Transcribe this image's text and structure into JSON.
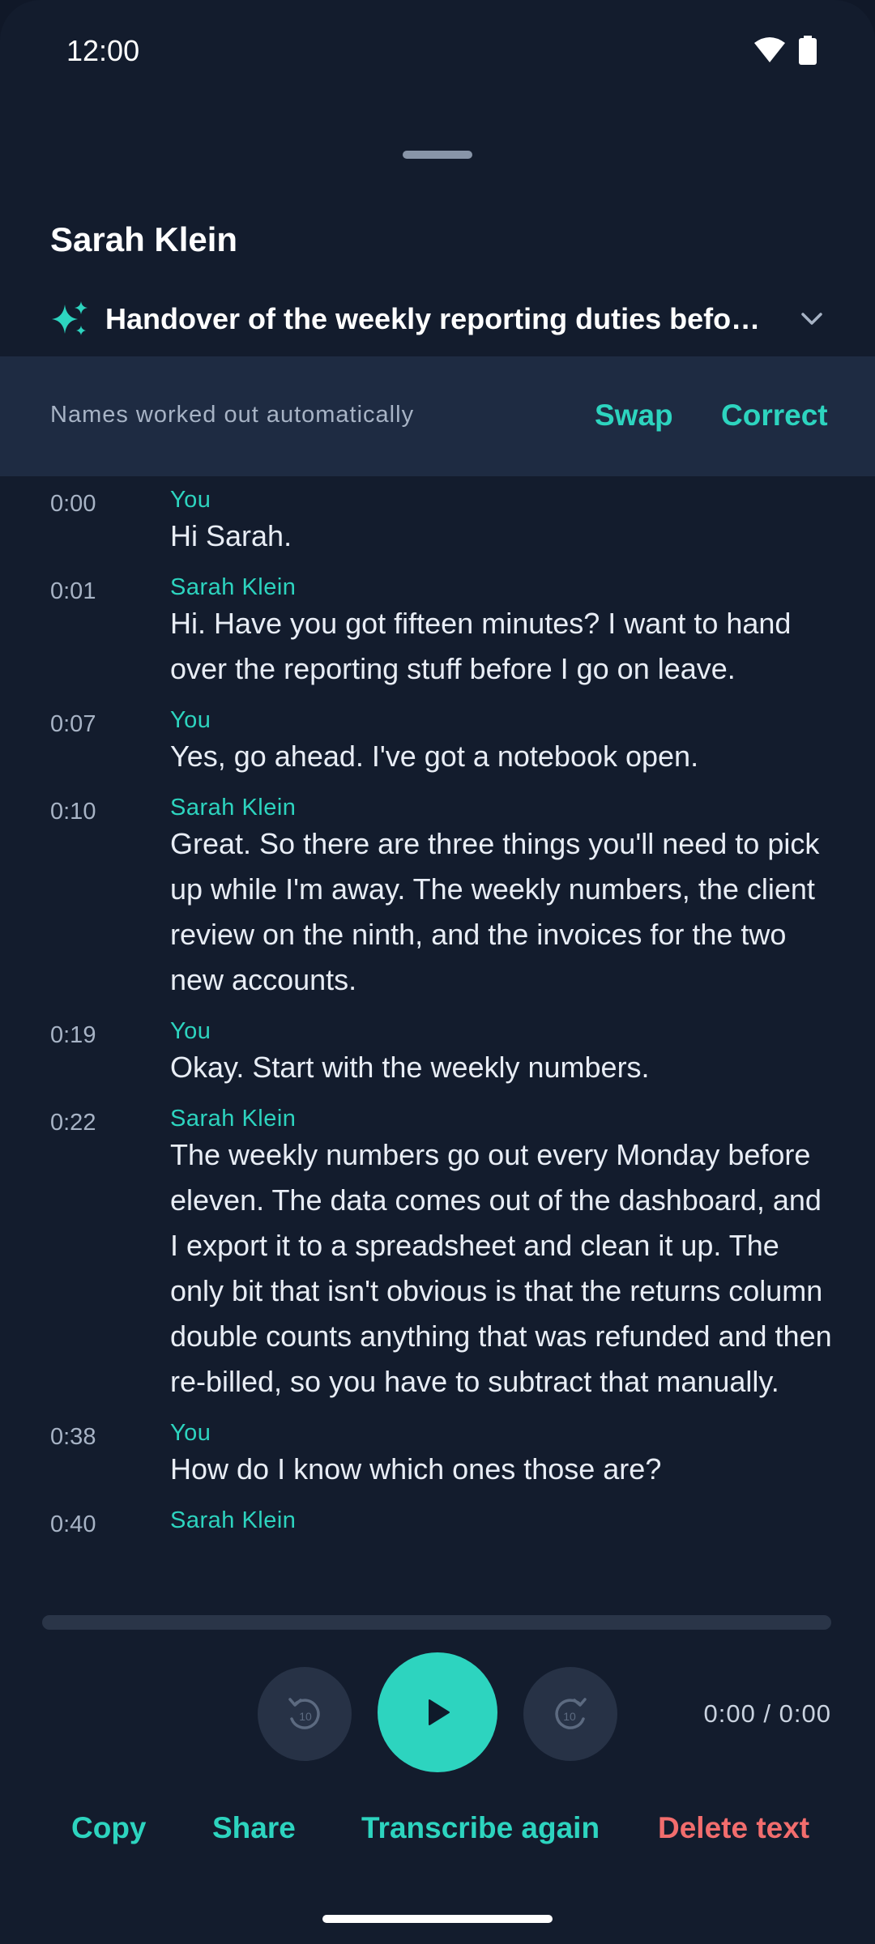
{
  "status_bar": {
    "time": "12:00"
  },
  "header": {
    "speaker_title": "Sarah Klein",
    "summary": "Handover of the weekly reporting duties before leave"
  },
  "names_banner": {
    "label": "Names worked out automatically",
    "swap_label": "Swap",
    "correct_label": "Correct"
  },
  "transcript": [
    {
      "time": "0:00",
      "speaker": "You",
      "text": "Hi Sarah."
    },
    {
      "time": "0:01",
      "speaker": "Sarah Klein",
      "text": "Hi. Have you got fifteen minutes? I want to hand over the reporting stuff before I go on leave."
    },
    {
      "time": "0:07",
      "speaker": "You",
      "text": "Yes, go ahead. I've got a notebook open."
    },
    {
      "time": "0:10",
      "speaker": "Sarah Klein",
      "text": "Great. So there are three things you'll need to pick up while I'm away. The weekly numbers, the client review on the ninth, and the invoices for the two new accounts."
    },
    {
      "time": "0:19",
      "speaker": "You",
      "text": "Okay. Start with the weekly numbers."
    },
    {
      "time": "0:22",
      "speaker": "Sarah Klein",
      "text": "The weekly numbers go out every Monday before eleven. The data comes out of the dashboard, and I export it to a spreadsheet and clean it up. The only bit that isn't obvious is that the returns column double counts anything that was refunded and then re-billed, so you have to subtract that manually."
    },
    {
      "time": "0:38",
      "speaker": "You",
      "text": "How do I know which ones those are?"
    },
    {
      "time": "0:40",
      "speaker": "Sarah Klein",
      "text": ""
    }
  ],
  "player": {
    "progress": 0,
    "time_readout": "0:00 / 0:00",
    "skip_seconds": "10"
  },
  "actions": {
    "copy": "Copy",
    "share": "Share",
    "transcribe_again": "Transcribe again",
    "delete_text": "Delete text"
  },
  "colors": {
    "accent": "#2dd4bf",
    "danger": "#f26d6d",
    "background": "#131c2d",
    "banner": "#1e2b42"
  }
}
